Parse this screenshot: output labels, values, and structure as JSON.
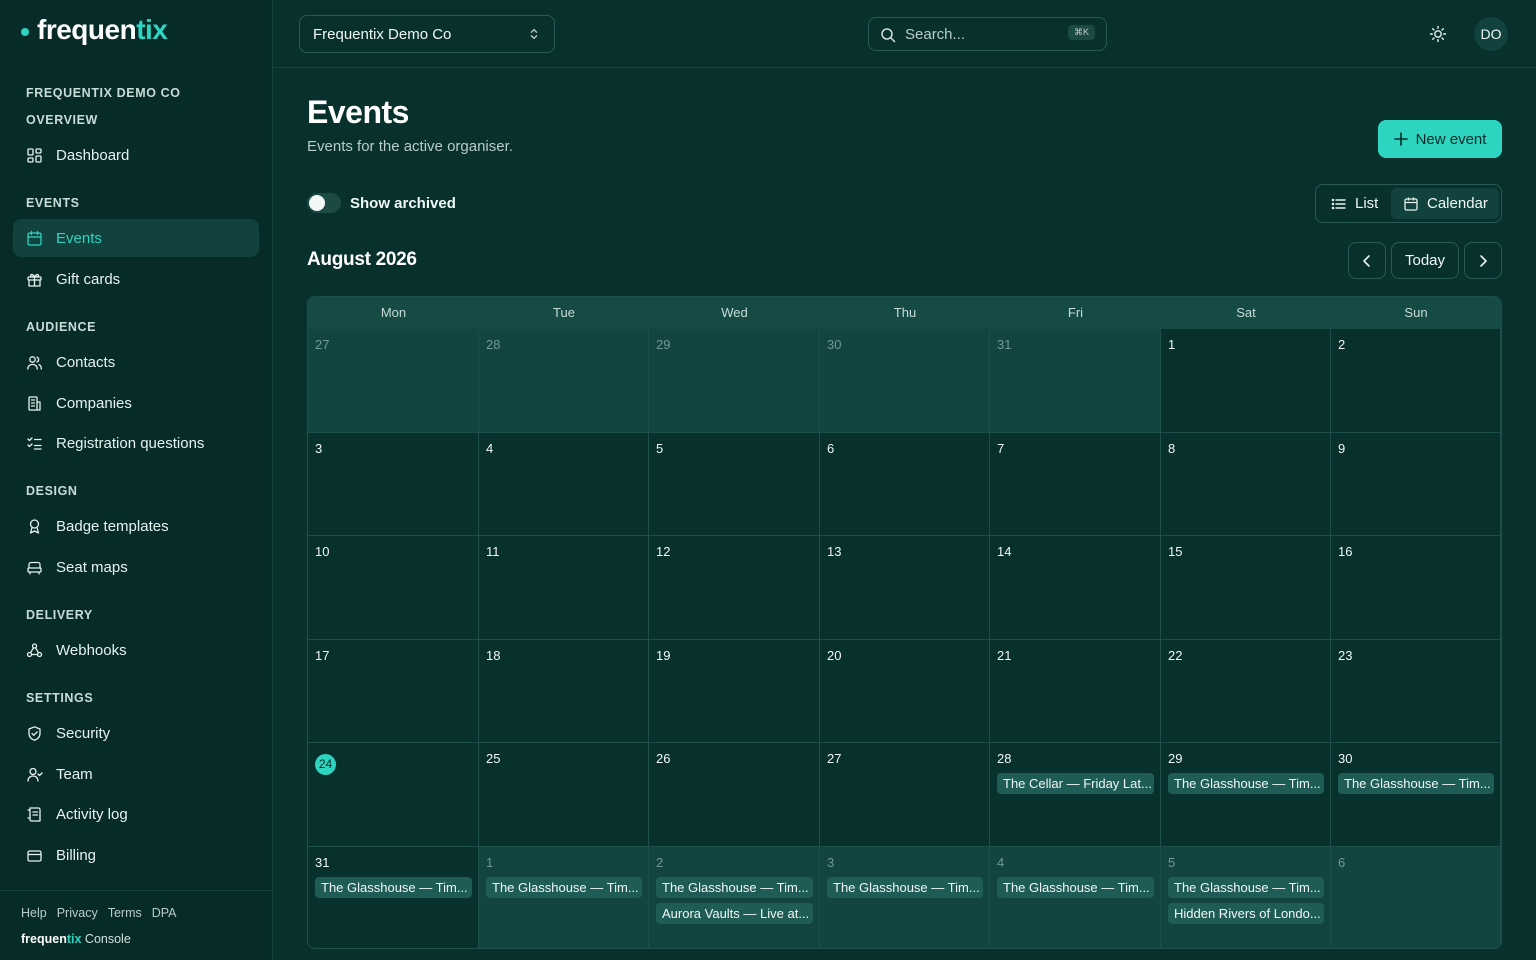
{
  "brand": {
    "name_main": "frequen",
    "name_accent": "tix"
  },
  "sidebar": {
    "org": "FREQUENTIX DEMO CO",
    "sections": [
      {
        "label": "OVERVIEW",
        "items": [
          {
            "label": "Dashboard",
            "icon": "dashboard-icon"
          }
        ]
      },
      {
        "label": "EVENTS",
        "items": [
          {
            "label": "Events",
            "icon": "calendar-icon",
            "active": true
          },
          {
            "label": "Gift cards",
            "icon": "gift-icon"
          }
        ]
      },
      {
        "label": "AUDIENCE",
        "items": [
          {
            "label": "Contacts",
            "icon": "users-icon"
          },
          {
            "label": "Companies",
            "icon": "building-icon"
          },
          {
            "label": "Registration questions",
            "icon": "checklist-icon"
          }
        ]
      },
      {
        "label": "DESIGN",
        "items": [
          {
            "label": "Badge templates",
            "icon": "badge-icon"
          },
          {
            "label": "Seat maps",
            "icon": "seat-icon"
          }
        ]
      },
      {
        "label": "DELIVERY",
        "items": [
          {
            "label": "Webhooks",
            "icon": "webhook-icon"
          }
        ]
      },
      {
        "label": "SETTINGS",
        "items": [
          {
            "label": "Security",
            "icon": "shield-icon"
          },
          {
            "label": "Team",
            "icon": "team-icon"
          },
          {
            "label": "Activity log",
            "icon": "log-icon"
          },
          {
            "label": "Billing",
            "icon": "card-icon"
          }
        ]
      }
    ],
    "footer_links": [
      "Help",
      "Privacy",
      "Terms",
      "DPA"
    ],
    "footer_brand_main": "frequen",
    "footer_brand_accent": "tix",
    "footer_brand_suffix": " Console"
  },
  "topbar": {
    "org_select": "Frequentix Demo Co",
    "search_placeholder": "Search...",
    "search_shortcut": "⌘K",
    "avatar": "DO"
  },
  "page": {
    "title": "Events",
    "subtitle": "Events for the active organiser.",
    "new_event_label": "New event",
    "show_archived_label": "Show archived",
    "show_archived_on": false,
    "view_list_label": "List",
    "view_calendar_label": "Calendar",
    "active_view": "Calendar",
    "month_label": "August 2026",
    "today_label": "Today"
  },
  "calendar": {
    "weekdays": [
      "Mon",
      "Tue",
      "Wed",
      "Thu",
      "Fri",
      "Sat",
      "Sun"
    ],
    "today": 24,
    "weeks": [
      [
        {
          "d": "27",
          "out": true
        },
        {
          "d": "28",
          "out": true
        },
        {
          "d": "29",
          "out": true
        },
        {
          "d": "30",
          "out": true
        },
        {
          "d": "31",
          "out": true
        },
        {
          "d": "1"
        },
        {
          "d": "2"
        }
      ],
      [
        {
          "d": "3"
        },
        {
          "d": "4"
        },
        {
          "d": "5"
        },
        {
          "d": "6"
        },
        {
          "d": "7"
        },
        {
          "d": "8"
        },
        {
          "d": "9"
        }
      ],
      [
        {
          "d": "10"
        },
        {
          "d": "11"
        },
        {
          "d": "12"
        },
        {
          "d": "13"
        },
        {
          "d": "14"
        },
        {
          "d": "15"
        },
        {
          "d": "16"
        }
      ],
      [
        {
          "d": "17"
        },
        {
          "d": "18"
        },
        {
          "d": "19"
        },
        {
          "d": "20"
        },
        {
          "d": "21"
        },
        {
          "d": "22"
        },
        {
          "d": "23"
        }
      ],
      [
        {
          "d": "24",
          "today": true
        },
        {
          "d": "25"
        },
        {
          "d": "26"
        },
        {
          "d": "27"
        },
        {
          "d": "28",
          "events": [
            "The Cellar — Friday Lat..."
          ]
        },
        {
          "d": "29",
          "events": [
            "The Glasshouse — Tim..."
          ]
        },
        {
          "d": "30",
          "events": [
            "The Glasshouse — Tim..."
          ]
        }
      ],
      [
        {
          "d": "31",
          "events": [
            "The Glasshouse — Tim..."
          ]
        },
        {
          "d": "1",
          "out": true,
          "events": [
            "The Glasshouse — Tim..."
          ]
        },
        {
          "d": "2",
          "out": true,
          "events": [
            "The Glasshouse — Tim...",
            "Aurora Vaults — Live at..."
          ]
        },
        {
          "d": "3",
          "out": true,
          "events": [
            "The Glasshouse — Tim..."
          ]
        },
        {
          "d": "4",
          "out": true,
          "events": [
            "The Glasshouse — Tim..."
          ]
        },
        {
          "d": "5",
          "out": true,
          "events": [
            "The Glasshouse — Tim...",
            "Hidden Rivers of Londo..."
          ]
        },
        {
          "d": "6",
          "out": true
        }
      ]
    ]
  }
}
